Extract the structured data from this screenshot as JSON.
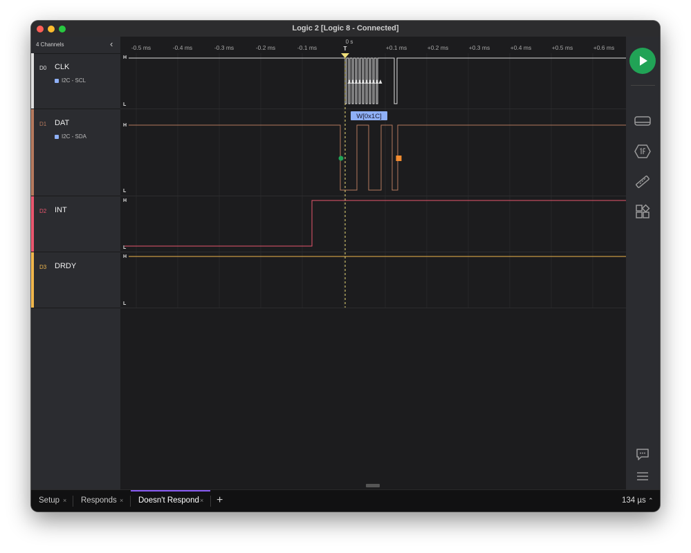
{
  "window": {
    "title": "Logic 2 [Logic 8 - Connected]"
  },
  "sidebar": {
    "header": "4 Channels",
    "channels": [
      {
        "id": "D0",
        "name": "CLK",
        "color": "#e0e0e0",
        "analyzer": "I2C - SCL"
      },
      {
        "id": "D1",
        "name": "DAT",
        "color": "#b67a5e",
        "analyzer": "I2C - SDA"
      },
      {
        "id": "D2",
        "name": "INT",
        "color": "#e9566e"
      },
      {
        "id": "D3",
        "name": "DRDY",
        "color": "#efb64c"
      }
    ]
  },
  "timeline": {
    "zero_label": "0 s",
    "trigger_label": "T",
    "ticks": [
      "-0.5 ms",
      "-0.4 ms",
      "-0.3 ms",
      "-0.2 ms",
      "-0.1 ms",
      "+0.1 ms",
      "+0.2 ms",
      "+0.3 ms",
      "+0.4 ms",
      "+0.5 ms",
      "+0.6 ms"
    ]
  },
  "levels": {
    "high": "H",
    "low": "L"
  },
  "decode": {
    "label": "W[0x1C]",
    "color": "#8fb0f7"
  },
  "colors": {
    "trigger": "#f0e07a",
    "start_marker": "#21a356",
    "stop_marker": "#f28b30",
    "accent": "#8a5cf5"
  },
  "tabs": [
    {
      "label": "Setup",
      "close": "×"
    },
    {
      "label": "Responds",
      "close": "×"
    },
    {
      "label": "Doesn't Respond",
      "close": "×",
      "active": true
    }
  ],
  "add_tab": "+",
  "status": {
    "duration": "134 µs",
    "chevron": "⌃"
  }
}
